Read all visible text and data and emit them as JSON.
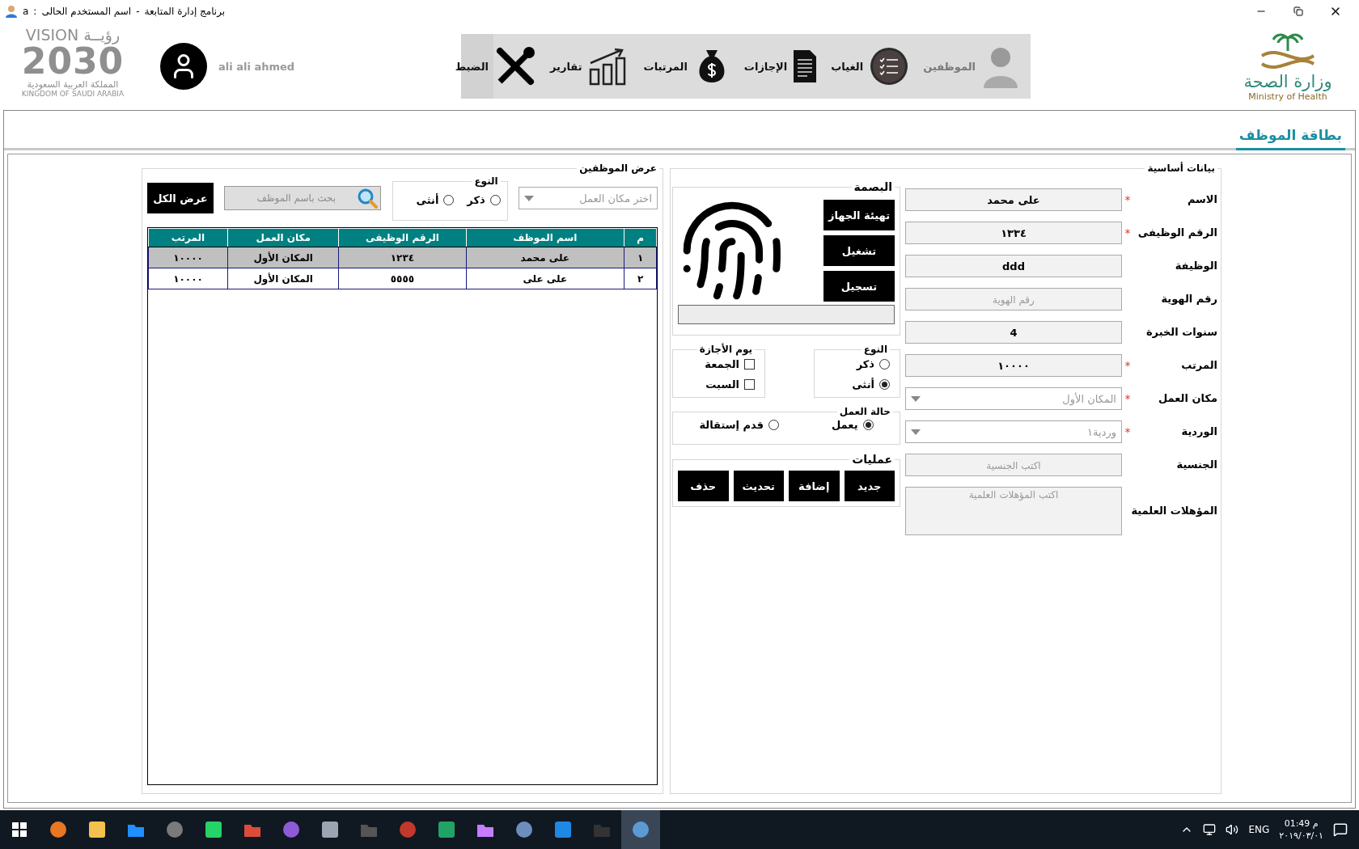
{
  "window": {
    "title": "برنامج إدارة المتابعة",
    "separator": "-",
    "user_label": "اسم المستخدم الحالى",
    "colon": ":",
    "user": "a"
  },
  "header": {
    "vision_logo": {
      "word_en": "VISION",
      "word_ar": "رؤيــة",
      "year": "2030",
      "country_ar": "المملكة العربية السعودية",
      "country_en": "KINGDOM OF SAUDI ARABIA"
    },
    "user_name": "ali ali ahmed",
    "ministry_logo": {
      "name_ar": "وزارة الصحة",
      "name_en": "Ministry of Health"
    }
  },
  "nav": [
    {
      "label": "الموظفين",
      "kind": "person",
      "disabled": true
    },
    {
      "label": "الغياب",
      "kind": "checklist",
      "disabled": false
    },
    {
      "label": "الإجازات",
      "kind": "document",
      "disabled": false
    },
    {
      "label": "المرتبات",
      "kind": "money",
      "disabled": false
    },
    {
      "label": "تقارير",
      "kind": "chart",
      "disabled": false
    },
    {
      "label": "الضبط",
      "kind": "tools",
      "disabled": false
    }
  ],
  "page_tab": {
    "label": "بطاقة الموظف",
    "selected": true
  },
  "employee_list": {
    "title": "عرض الموظفين",
    "workplace_select": {
      "placeholder": "اختر مكان العمل"
    },
    "gender_filter": {
      "title": "النوع",
      "options": [
        {
          "label": "ذكر",
          "selected": false
        },
        {
          "label": "أنثى",
          "selected": false
        }
      ]
    },
    "search": {
      "placeholder": "بحث باسم الموظف"
    },
    "show_all_button": "عرض الكل",
    "table": {
      "columns": [
        "م",
        "اسم الموظف",
        "الرقم الوظيفى",
        "مكان العمل",
        "المرتب"
      ],
      "rows": [
        {
          "selected": true,
          "cells": [
            "١",
            "على محمد",
            "١٢٣٤",
            "المكان الأول",
            "١٠٠٠٠"
          ]
        },
        {
          "selected": false,
          "cells": [
            "٢",
            "على على",
            "٥٥٥٥",
            "المكان الأول",
            "١٠٠٠٠"
          ]
        }
      ]
    }
  },
  "basic_data": {
    "title": "بيانات أساسية",
    "fields": [
      {
        "label": "الاسم",
        "required_mark": "*",
        "kind": "text",
        "value": "على محمد"
      },
      {
        "label": "الرقم الوظيفى",
        "required_mark": "*",
        "kind": "text",
        "value": "١٣٣٤"
      },
      {
        "label": "الوظيفة",
        "kind": "text",
        "value": "ddd"
      },
      {
        "label": "رقم الهوية",
        "kind": "text",
        "placeholder": "رقم الهوية"
      },
      {
        "label": "سنوات الخبرة",
        "kind": "text",
        "value": "4"
      },
      {
        "label": "المرتب",
        "required_mark": "*",
        "kind": "text",
        "value": "١٠٠٠٠"
      },
      {
        "label": "مكان العمل",
        "required_mark": "*",
        "kind": "select",
        "placeholder": "المكان الأول"
      },
      {
        "label": "الوردية",
        "required_mark": "*",
        "kind": "select",
        "placeholder": "وردية١"
      },
      {
        "label": "الجنسية",
        "kind": "text",
        "placeholder": "اكتب الجنسية"
      },
      {
        "label": "المؤهلات العلمية",
        "kind": "textarea",
        "placeholder": "اكتب المؤهلات العلمية"
      }
    ],
    "fingerprint": {
      "title": "البصمة",
      "buttons": [
        "تهيئة الجهاز",
        "تشغيل",
        "تسجيل"
      ]
    },
    "gender": {
      "title": "النوع",
      "options": [
        {
          "label": "ذكر",
          "selected": false
        },
        {
          "label": "أنثى",
          "selected": true
        }
      ]
    },
    "vacation_days": {
      "title": "يوم الأجازة",
      "options": [
        {
          "label": "الجمعة",
          "checked": false
        },
        {
          "label": "السبت",
          "checked": false
        }
      ]
    },
    "work_status": {
      "title": "حالة العمل",
      "options": [
        {
          "label": "يعمل",
          "selected": true
        },
        {
          "label": "قدم إستقالة",
          "selected": false
        }
      ]
    },
    "operations": {
      "title": "عمليات",
      "buttons": [
        "جديد",
        "إضافة",
        "تحديث",
        "حذف"
      ]
    }
  },
  "taskbar": {
    "apps": [
      {
        "selected": false
      },
      {
        "selected": false
      },
      {
        "selected": false
      },
      {
        "selected": false
      },
      {
        "selected": false
      },
      {
        "selected": false
      },
      {
        "selected": false
      },
      {
        "selected": false
      },
      {
        "selected": false
      },
      {
        "selected": false
      },
      {
        "selected": false
      },
      {
        "selected": false
      },
      {
        "selected": false
      },
      {
        "selected": false
      },
      {
        "selected": false
      },
      {
        "selected": true
      }
    ],
    "language": "ENG",
    "time": "01:49 م",
    "date": "٢٠١٩/٠٣/٠١"
  }
}
